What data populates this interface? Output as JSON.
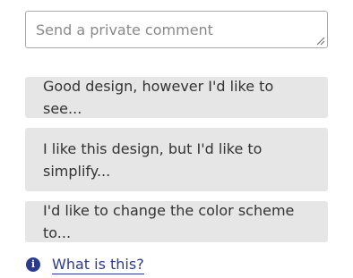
{
  "comment": {
    "placeholder": "Send a private comment",
    "value": ""
  },
  "suggestions": [
    {
      "label": "Good design, however I'd like to see..."
    },
    {
      "label": "I like this design, but I'd like to simplify..."
    },
    {
      "label": "I'd like to change the color scheme to..."
    }
  ],
  "help": {
    "icon": "info-icon",
    "link_label": "What is this?"
  },
  "colors": {
    "accent": "#2b3a8f",
    "suggestion_bg": "#e6e6e6",
    "text": "#333333"
  }
}
